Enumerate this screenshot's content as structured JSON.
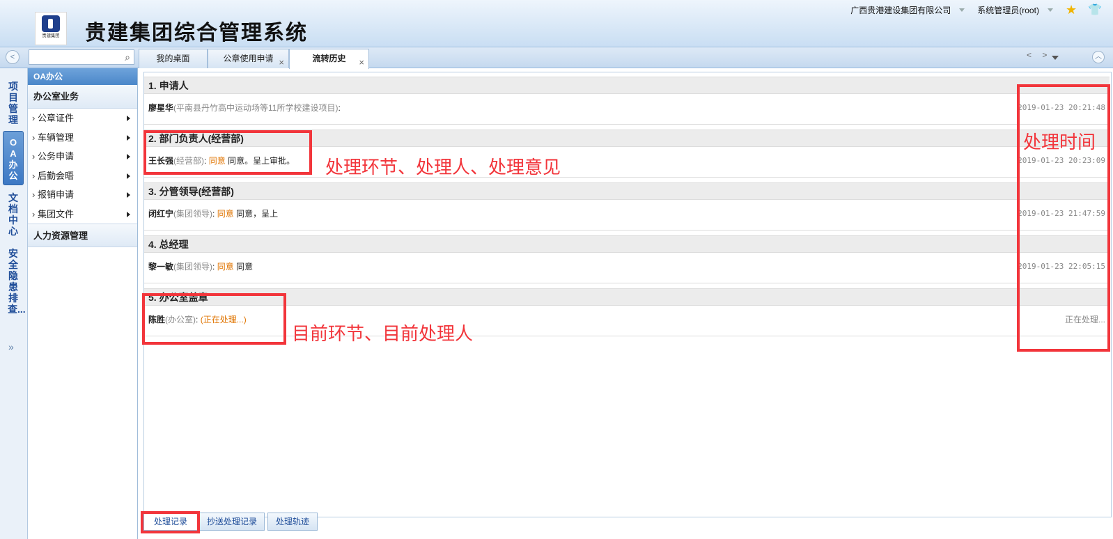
{
  "header": {
    "logo_caption": "贵建集团",
    "title": "贵建集团综合管理系统",
    "company": "广西贵港建设集团有限公司",
    "user": "系统管理员(root)"
  },
  "tabs": [
    {
      "label": "我的桌面"
    },
    {
      "label": "公章使用申请"
    },
    {
      "label": "流转历史"
    }
  ],
  "tab_nav": "< >",
  "vnav": [
    {
      "label": "项目管理"
    },
    {
      "label": "OA办公"
    },
    {
      "label": "文档中心"
    },
    {
      "label": "安全隐患排查..."
    }
  ],
  "menu": {
    "header": "OA办公",
    "group1": "办公室业务",
    "items": [
      {
        "label": "公章证件"
      },
      {
        "label": "车辆管理"
      },
      {
        "label": "公务申请"
      },
      {
        "label": "后勤会晤"
      },
      {
        "label": "报销申请"
      },
      {
        "label": "集团文件"
      }
    ],
    "group2": "人力资源管理"
  },
  "steps": [
    {
      "title": "1. 申请人",
      "person": "廖星华",
      "dept": "(平南县丹竹高中运动场等11所学校建设项目)",
      "colon": ":",
      "status": "",
      "comment": "",
      "time": "2019-01-23 20:21:48"
    },
    {
      "title": "2. 部门负责人(经营部)",
      "person": "王长强",
      "dept": "(经营部)",
      "colon": ":",
      "status": "同意",
      "comment": "同意。呈上审批。",
      "time": "2019-01-23 20:23:09"
    },
    {
      "title": "3. 分管领导(经营部)",
      "person": "闭红宁",
      "dept": "(集团领导)",
      "colon": ":",
      "status": "同意",
      "comment": "同意，呈上",
      "time": "2019-01-23 21:47:59"
    },
    {
      "title": "4. 总经理",
      "person": "黎一敏",
      "dept": "(集团领导)",
      "colon": ":",
      "status": "同意",
      "comment": "同意",
      "time": "2019-01-23 22:05:15"
    },
    {
      "title": "5. 办公室盖章",
      "person": "陈胜",
      "dept": "(办公室)",
      "colon": ":",
      "status": "(正在处理...)",
      "comment": "",
      "time": "正在处理..."
    }
  ],
  "bottom_tabs": [
    {
      "label": "处理记录"
    },
    {
      "label": "抄送处理记录"
    },
    {
      "label": "处理轨迹"
    }
  ],
  "annotations": {
    "time": "处理时间",
    "step_info": "处理环节、处理人、处理意见",
    "current": "目前环节、目前处理人"
  }
}
